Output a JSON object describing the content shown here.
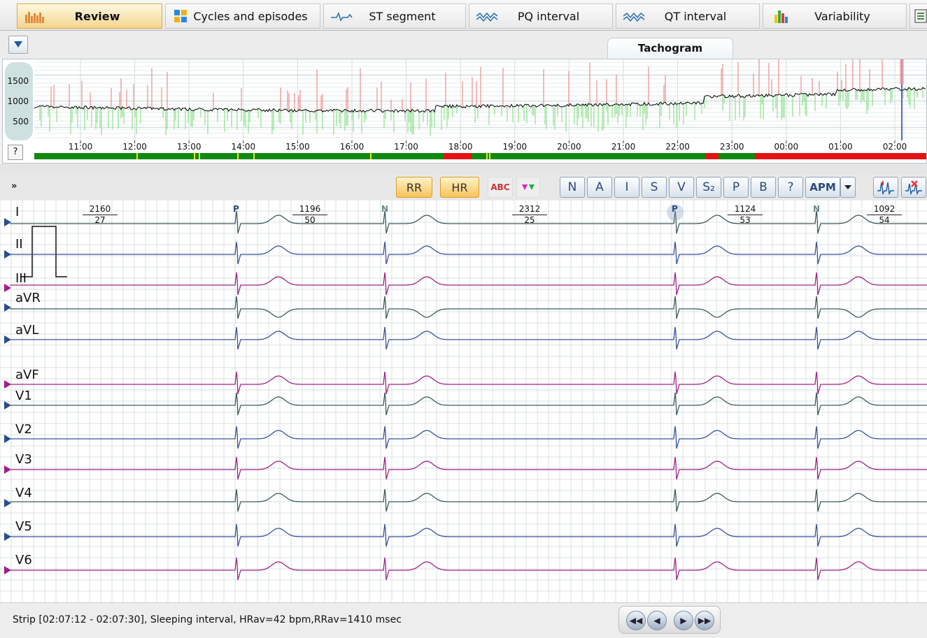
{
  "tabs": [
    {
      "label": "Review",
      "icon": "bars-icon",
      "active": true
    },
    {
      "label": "Cycles and episodes",
      "icon": "grid-icon"
    },
    {
      "label": "ST segment",
      "icon": "st-wave-icon"
    },
    {
      "label": "PQ interval",
      "icon": "pq-wave-icon"
    },
    {
      "label": "QT interval",
      "icon": "qt-wave-icon"
    },
    {
      "label": "Variability",
      "icon": "histogram-icon"
    }
  ],
  "tachogram": {
    "tab_label": "Tachogram",
    "y_ticks": [
      "1500",
      "1000",
      "500"
    ],
    "x_ticks": [
      "11:00",
      "12:00",
      "13:00",
      "14:00",
      "15:00",
      "16:00",
      "17:00",
      "18:00",
      "19:00",
      "20:00",
      "21:00",
      "22:00",
      "23:00",
      "00:00",
      "01:00",
      "02:00"
    ],
    "help_label": "?",
    "colors": {
      "rr": "#f08c8c",
      "rr_low": "#8ce08c",
      "trend": "#000000",
      "cursor": "#1f2bd6",
      "bar_good": "#0f8a0f",
      "bar_bad": "#e31313",
      "bar_mark": "#e8e800"
    }
  },
  "ecg_toolbar": {
    "rr_label": "RR",
    "hr_label": "HR",
    "abc_label": "ABC",
    "class_buttons": [
      "N",
      "A",
      "I",
      "S",
      "V",
      "S₂",
      "P",
      "B",
      "?"
    ],
    "apm_label": "APM"
  },
  "ecg": {
    "leads": [
      "I",
      "II",
      "III",
      "aVR",
      "aVL",
      "aVF",
      "V1",
      "V2",
      "V3",
      "V4",
      "V5",
      "V6"
    ],
    "beat_labels": [
      "P",
      "N",
      "P",
      "N"
    ],
    "rr_labels": [
      {
        "ms": "2160",
        "bpm": "27"
      },
      {
        "ms": "1196",
        "bpm": "50"
      },
      {
        "ms": "2312",
        "bpm": "25"
      },
      {
        "ms": "1124",
        "bpm": "53"
      },
      {
        "ms": "1092",
        "bpm": "54"
      }
    ],
    "colors": {
      "lead_a": "#3d5a5a",
      "lead_b": "#3b4fa0",
      "lead_c": "#a0208a",
      "grid": "#d9e1e1"
    }
  },
  "status": {
    "text": "Strip [02:07:12 - 02:07:30], Sleeping interval,  HRav=42 bpm,RRav=1410 msec"
  }
}
